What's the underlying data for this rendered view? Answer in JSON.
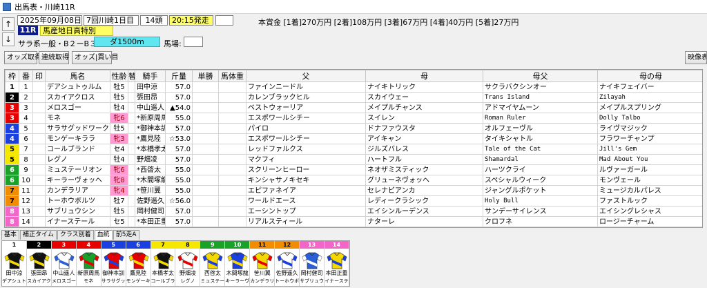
{
  "window_title": "出馬表・川崎11R",
  "header": {
    "date": "2025年09月08日(月)",
    "meeting": "7回川崎1日目",
    "field_size": "14頭",
    "post_time": "20:15発走",
    "race_no": "11R",
    "race_name": "馬産地日高特別",
    "race_class": "サラ系一般・B２ーB３",
    "distance": "ダ1500m",
    "track_label": "馬場:",
    "prize_text": "本賞金 [1着]270万円 [2着]108万円 [3着]67万円 [4着]40万円 [5着]27万円"
  },
  "toolbar": {
    "odds_btn": "オッズ取得",
    "renzoku_btn": "連続取得",
    "buy_btn": "オッズ|買い目",
    "video_btn": "映像表"
  },
  "columns": [
    "枠",
    "番",
    "印",
    "馬名",
    "性齢",
    "替",
    "騎手",
    "斤量",
    "単勝",
    "馬体重",
    "父",
    "母",
    "母父",
    "母の母"
  ],
  "waku_colors": {
    "1": {
      "bg": "#ffffff",
      "fg": "#000000"
    },
    "2": {
      "bg": "#000000",
      "fg": "#ffffff"
    },
    "3": {
      "bg": "#e60000",
      "fg": "#ffffff"
    },
    "4": {
      "bg": "#1c3fe0",
      "fg": "#ffffff"
    },
    "5": {
      "bg": "#f5e800",
      "fg": "#000000"
    },
    "6": {
      "bg": "#1aa12a",
      "fg": "#ffffff"
    },
    "7": {
      "bg": "#f28c00",
      "fg": "#000000"
    },
    "8": {
      "bg": "#f266c8",
      "fg": "#ffffff"
    }
  },
  "entries": [
    {
      "waku": "1",
      "no": "1",
      "mark": "",
      "name": "デアシュトゥルム",
      "sexage": "牡5",
      "filly": false,
      "change": "",
      "jockey": "田中涼",
      "weight": "57.0",
      "odds": "",
      "body": "",
      "sire": "ファインニードル",
      "dam": "ナイキトリック",
      "damsire": "サクラバクシンオー",
      "damdam": "ナイキフェイバー"
    },
    {
      "waku": "2",
      "no": "2",
      "mark": "",
      "name": "スカイアクロス",
      "sexage": "牡5",
      "filly": false,
      "change": "",
      "jockey": "張田昂",
      "weight": "57.0",
      "odds": "",
      "body": "",
      "sire": "カレンブラックヒル",
      "dam": "スカイウェー",
      "damsire": "Trans Island",
      "damdam": "Zilayah"
    },
    {
      "waku": "3",
      "no": "3",
      "mark": "",
      "name": "メロスゴー",
      "sexage": "牡4",
      "filly": false,
      "change": "",
      "jockey": "中山遥人",
      "weight": "▲54.0",
      "odds": "",
      "body": "",
      "sire": "ベストウォーリア",
      "dam": "メイプルチャンス",
      "damsire": "アドマイヤムーン",
      "damdam": "メイプルスプリング"
    },
    {
      "waku": "3",
      "no": "4",
      "mark": "",
      "name": "モネ",
      "sexage": "牝6",
      "filly": true,
      "change": "",
      "jockey": "*新原周馬",
      "weight": "55.0",
      "odds": "",
      "body": "",
      "sire": "エスポワールシチー",
      "dam": "スイレン",
      "damsire": "Roman Ruler",
      "damdam": "Dolly Talbo"
    },
    {
      "waku": "4",
      "no": "5",
      "mark": "",
      "name": "サラサグッドワーク",
      "sexage": "牡5",
      "filly": false,
      "change": "",
      "jockey": "*御神本訓",
      "weight": "57.0",
      "odds": "",
      "body": "",
      "sire": "パイロ",
      "dam": "ドナファウスタ",
      "damsire": "オルフェーヴル",
      "damdam": "ライヴマジック"
    },
    {
      "waku": "4",
      "no": "6",
      "mark": "",
      "name": "モンゲーキララ",
      "sexage": "牝3",
      "filly": true,
      "change": "",
      "jockey": "*鷹見陸",
      "weight": "☆53.0",
      "odds": "",
      "body": "",
      "sire": "エスポワールシチー",
      "dam": "アイキャン",
      "damsire": "タイキシャトル",
      "damdam": "フラワーチャンプ"
    },
    {
      "waku": "5",
      "no": "7",
      "mark": "",
      "name": "コールブランド",
      "sexage": "セ4",
      "filly": false,
      "change": "",
      "jockey": "*本橋孝太",
      "weight": "57.0",
      "odds": "",
      "body": "",
      "sire": "レッドファルクス",
      "dam": "ジルズバレス",
      "damsire": "Tale of the Cat",
      "damdam": "Jill's Gem"
    },
    {
      "waku": "5",
      "no": "8",
      "mark": "",
      "name": "レグノ",
      "sexage": "牡4",
      "filly": false,
      "change": "",
      "jockey": "野畑凌",
      "weight": "57.0",
      "odds": "",
      "body": "",
      "sire": "マクフィ",
      "dam": "ハートフル",
      "damsire": "Shamardal",
      "damdam": "Mad About You"
    },
    {
      "waku": "6",
      "no": "9",
      "mark": "",
      "name": "ミュステーリオン",
      "sexage": "牝6",
      "filly": true,
      "change": "",
      "jockey": "*西啓太",
      "weight": "55.0",
      "odds": "",
      "body": "",
      "sire": "スクリーンヒーロー",
      "dam": "ネオザミスティック",
      "damsire": "ハーツクライ",
      "damdam": "ルヴァーガール"
    },
    {
      "waku": "6",
      "no": "10",
      "mark": "",
      "name": "キーラーヴォッヘ",
      "sexage": "牝8",
      "filly": true,
      "change": "",
      "jockey": "*木間塚龍",
      "weight": "55.0",
      "odds": "",
      "body": "",
      "sire": "キンシャサノキセキ",
      "dam": "グリューネヴォッヘ",
      "damsire": "スペシャルウィーク",
      "damdam": "モンヴェール"
    },
    {
      "waku": "7",
      "no": "11",
      "mark": "",
      "name": "カンデラリア",
      "sexage": "牝4",
      "filly": true,
      "change": "",
      "jockey": "*笹川翼",
      "weight": "55.0",
      "odds": "",
      "body": "",
      "sire": "エピファネイア",
      "dam": "セレナビアンカ",
      "damsire": "ジャングルポケット",
      "damdam": "ミュージカルパレス"
    },
    {
      "waku": "7",
      "no": "12",
      "mark": "",
      "name": "トーホウボルツ",
      "sexage": "牡7",
      "filly": false,
      "change": "",
      "jockey": "佐野遥久",
      "weight": "☆56.0",
      "odds": "",
      "body": "",
      "sire": "ワールドエース",
      "dam": "レディークラシック",
      "damsire": "Holy Bull",
      "damdam": "ファストルック"
    },
    {
      "waku": "8",
      "no": "13",
      "mark": "",
      "name": "サブリュウシン",
      "sexage": "牡5",
      "filly": false,
      "change": "",
      "jockey": "岡村健司",
      "weight": "57.0",
      "odds": "",
      "body": "",
      "sire": "エーシントップ",
      "dam": "エイシンルーデンス",
      "damsire": "サンデーサイレンス",
      "damdam": "エイシングレシャス"
    },
    {
      "waku": "8",
      "no": "14",
      "mark": "",
      "name": "イナーステール",
      "sexage": "セ5",
      "filly": false,
      "change": "",
      "jockey": "*本田正重",
      "weight": "57.0",
      "odds": "",
      "body": "",
      "sire": "リアルスティール",
      "dam": "ナターレ",
      "damsire": "クロフネ",
      "damdam": "ロージーチャーム"
    }
  ],
  "bottom_tabs": [
    "基本",
    "補正タイム",
    "クラス別着",
    "血統",
    "前5走A"
  ],
  "active_tab": "血統",
  "silks": [
    {
      "no": "1",
      "jockey": "田中涼",
      "horse": "デアシュト",
      "c1": "#111111",
      "c2": "#f5d800"
    },
    {
      "no": "2",
      "jockey": "張田昂",
      "horse": "スカイアク",
      "c1": "#111111",
      "c2": "#f5d800"
    },
    {
      "no": "3",
      "jockey": "中山遥人",
      "horse": "メロスゴー",
      "c1": "#ffffff",
      "c2": "#2a5fd8"
    },
    {
      "no": "4",
      "jockey": "新原周馬",
      "horse": "モネ",
      "c1": "#1aa12a",
      "c2": "#e60000"
    },
    {
      "no": "5",
      "jockey": "御神本訓",
      "horse": "サラサグッ",
      "c1": "#e60000",
      "c2": "#1c3fe0"
    },
    {
      "no": "6",
      "jockey": "鷹見陸",
      "horse": "モンゲーキ",
      "c1": "#e60000",
      "c2": "#f5d800"
    },
    {
      "no": "7",
      "jockey": "本橋孝太",
      "horse": "コールブラ",
      "c1": "#111111",
      "c2": "#f5d800"
    },
    {
      "no": "8",
      "jockey": "野畑凌",
      "horse": "レグノ",
      "c1": "#ffffff",
      "c2": "#e60000"
    },
    {
      "no": "9",
      "jockey": "西啓太",
      "horse": "ミュステー",
      "c1": "#f5d800",
      "c2": "#1c3fe0"
    },
    {
      "no": "10",
      "jockey": "木間塚龍",
      "horse": "キーラーヴ",
      "c1": "#1c3fe0",
      "c2": "#f5d800"
    },
    {
      "no": "11",
      "jockey": "笹川翼",
      "horse": "カンデラリ",
      "c1": "#f5d800",
      "c2": "#e60000"
    },
    {
      "no": "12",
      "jockey": "佐野遥久",
      "horse": "トーホウボ",
      "c1": "#ffffff",
      "c2": "#1c3fe0"
    },
    {
      "no": "13",
      "jockey": "岡村健司",
      "horse": "サブリュウ",
      "c1": "#2a5fd8",
      "c2": "#ffffff"
    },
    {
      "no": "14",
      "jockey": "本田正重",
      "horse": "イナーステ",
      "c1": "#f5d800",
      "c2": "#1c3fe0"
    }
  ]
}
